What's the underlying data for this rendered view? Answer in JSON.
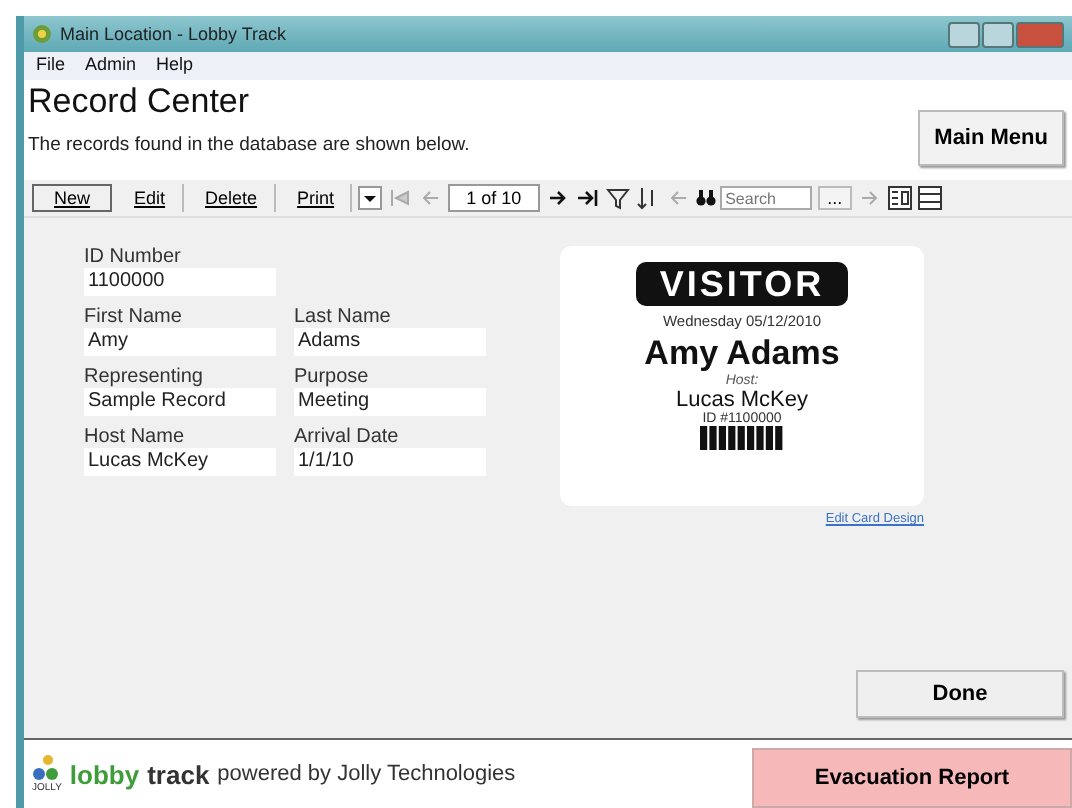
{
  "window": {
    "title": "Main Location - Lobby Track"
  },
  "menu": [
    "File",
    "Admin",
    "Help"
  ],
  "header": {
    "title": "Record Center",
    "subtitle": "The records found in the database are shown below.",
    "main_menu": "Main Menu"
  },
  "toolbar": {
    "buttons": [
      "New",
      "Edit",
      "Delete",
      "Print"
    ],
    "page": "1 of 10",
    "search": {
      "placeholder": "Search"
    },
    "more": "..."
  },
  "form": {
    "rows": [
      [
        {
          "label": "ID Number",
          "value": "1100000"
        }
      ],
      [
        {
          "label": "First Name",
          "value": "Amy"
        },
        {
          "label": "Last Name",
          "value": "Adams"
        }
      ],
      [
        {
          "label": "Representing",
          "value": "Sample Record"
        },
        {
          "label": "Purpose",
          "value": "Meeting"
        }
      ],
      [
        {
          "label": "Host Name",
          "value": "Lucas McKey"
        },
        {
          "label": "Arrival Date",
          "value": "1/1/10"
        }
      ]
    ]
  },
  "badge": {
    "header": "VISITOR",
    "date": "Wednesday 05/12/2010",
    "name": "Amy Adams",
    "host_label": "Host:",
    "host": "Lucas McKey",
    "id": "ID #1100000"
  },
  "edit_link": "Edit Card Design",
  "done": "Done",
  "footer": {
    "logo_text": "JOLLY",
    "brand_1": "lobby",
    "brand_2": "track",
    "powered": "powered by Jolly Technologies",
    "evacuation": "Evacuation Report"
  }
}
